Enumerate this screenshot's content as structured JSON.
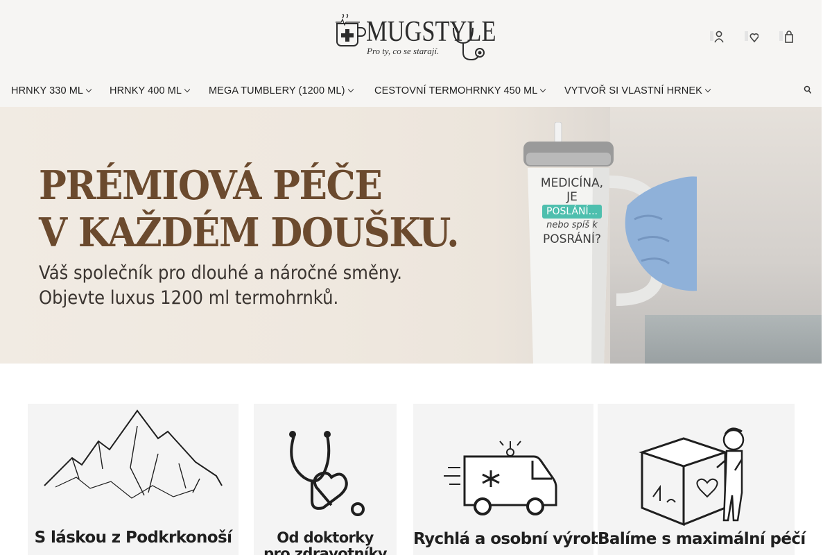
{
  "brand": {
    "name": "MUGSTYLE",
    "tagline": "Pro ty, co se starají."
  },
  "header_icons": [
    "user-icon",
    "heart-icon",
    "cart-icon"
  ],
  "nav": {
    "items": [
      {
        "label": "HRNKY 330 ML",
        "has_dropdown": true
      },
      {
        "label": "HRNKY 400 ML",
        "has_dropdown": true
      },
      {
        "label": "MEGA TUMBLERY (1200 ML)",
        "has_dropdown": true
      },
      {
        "label": "CESTOVNÍ TERMOHRNKY 450 ML",
        "has_dropdown": true
      },
      {
        "label": "VYTVOŘ SI VLASTNÍ HRNEK",
        "has_dropdown": true
      }
    ]
  },
  "hero": {
    "title": "PRÉMIOVÁ PÉČE\nV KAŽDÉM DOUŠKU.",
    "subtitle": "Váš společník pro dlouhé a náročné směny.\nObjevte luxus 1200 ml termohrnků.",
    "product_text": {
      "line1": "MEDICÍNA,",
      "line2": "JE",
      "line3": "POSLÁNÍ...",
      "line4": "nebo spíš k",
      "line5": "POSRÁNÍ?"
    },
    "colors": {
      "title": "#6b4a2e",
      "subtitle": "#3a3430",
      "accent": "#4ebfae"
    }
  },
  "features": [
    {
      "title": "S láskou z Podkrkonoší",
      "icon": "mountains-icon"
    },
    {
      "title": "Od doktorky\npro zdravotníky",
      "icon": "stethoscope-heart-icon"
    },
    {
      "title": "Rychlá a osobní výroba",
      "icon": "ambulance-icon"
    },
    {
      "title": "Balíme s maximální péčí",
      "icon": "package-boy-icon"
    }
  ]
}
